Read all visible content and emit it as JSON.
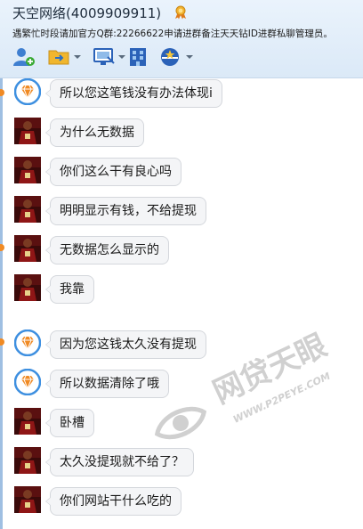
{
  "header": {
    "title": "天空网络(4009909911)",
    "notice": "遇繁忙时段请加官方Q群:22266622申请进群备注天天钻ID进群私聊管理员。"
  },
  "toolbar": {
    "icons": [
      "add-member-icon",
      "transfer-file-icon",
      "screen-share-icon",
      "app-grid-icon",
      "group-profile-icon"
    ]
  },
  "messages": [
    {
      "sender": "service",
      "text": "所以您这笔钱没有办法体现i"
    },
    {
      "sender": "user",
      "text": "为什么无数据"
    },
    {
      "sender": "user",
      "text": "你们这么干有良心吗"
    },
    {
      "sender": "user",
      "text": "明明显示有钱，不给提现"
    },
    {
      "sender": "user",
      "text": "无数据怎么显示的"
    },
    {
      "sender": "user",
      "text": "我靠"
    },
    {
      "sender": "service",
      "text": "因为您这钱太久没有提现"
    },
    {
      "sender": "service",
      "text": "所以数据清除了哦"
    },
    {
      "sender": "user",
      "text": "卧槽"
    },
    {
      "sender": "user",
      "text": "太久没提现就不给了？"
    },
    {
      "sender": "user",
      "text": "你们网站干什么吃的"
    }
  ],
  "watermark": {
    "brand": "网贷天眼",
    "url": "WWW.P2PEYE.COM"
  },
  "colors": {
    "header_bg": "#dbe9f7",
    "bubble_bg": "#f4f5f7",
    "accent_orange": "#f08a24",
    "service_avatar": "#3d8fe0"
  }
}
